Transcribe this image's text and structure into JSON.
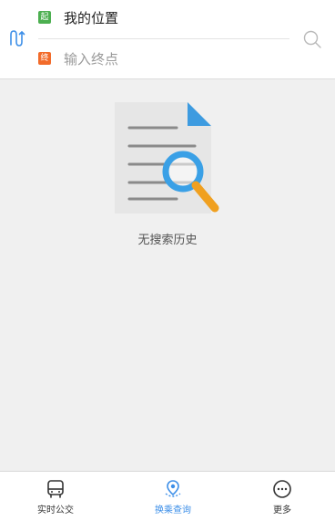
{
  "route": {
    "start_badge": "起",
    "start_label": "我的位置",
    "end_badge": "终",
    "end_placeholder": "输入终点"
  },
  "empty_state": {
    "message": "无搜索历史"
  },
  "tabbar": {
    "tabs": [
      {
        "label": "实时公交",
        "icon": "bus-icon",
        "active": false
      },
      {
        "label": "换乘查询",
        "icon": "route-location-icon",
        "active": true
      },
      {
        "label": "更多",
        "icon": "more-icon",
        "active": false
      }
    ]
  },
  "colors": {
    "active_tab": "#3d8fe8",
    "start_badge": "#4caf50",
    "end_badge": "#f26b2a"
  }
}
